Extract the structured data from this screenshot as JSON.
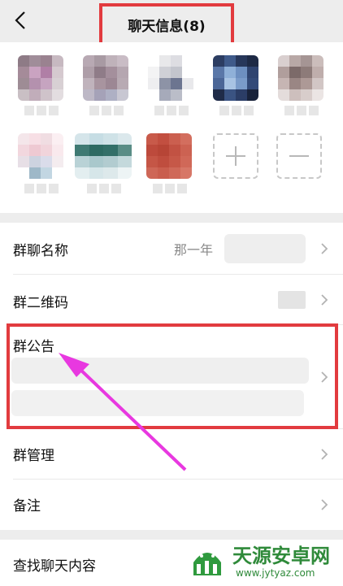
{
  "header": {
    "title": "聊天信息(8)",
    "back_icon": "chevron-left-icon"
  },
  "members": {
    "count": 8,
    "add_icon": "plus-icon",
    "remove_icon": "minus-icon"
  },
  "rows": {
    "group_name": {
      "label": "群聊名称",
      "value": "那一年"
    },
    "qr_code": {
      "label": "群二维码"
    },
    "announcement": {
      "label": "群公告"
    },
    "group_manage": {
      "label": "群管理"
    },
    "remark": {
      "label": "备注"
    },
    "search_chat": {
      "label": "查找聊天内容"
    }
  },
  "colors": {
    "background": "#ededed",
    "panel": "#ffffff",
    "highlight_border": "#e23b3f",
    "arrow": "#e838e0"
  },
  "watermark": {
    "text": "天源安卓网",
    "url": "www.jytyaz.com"
  }
}
